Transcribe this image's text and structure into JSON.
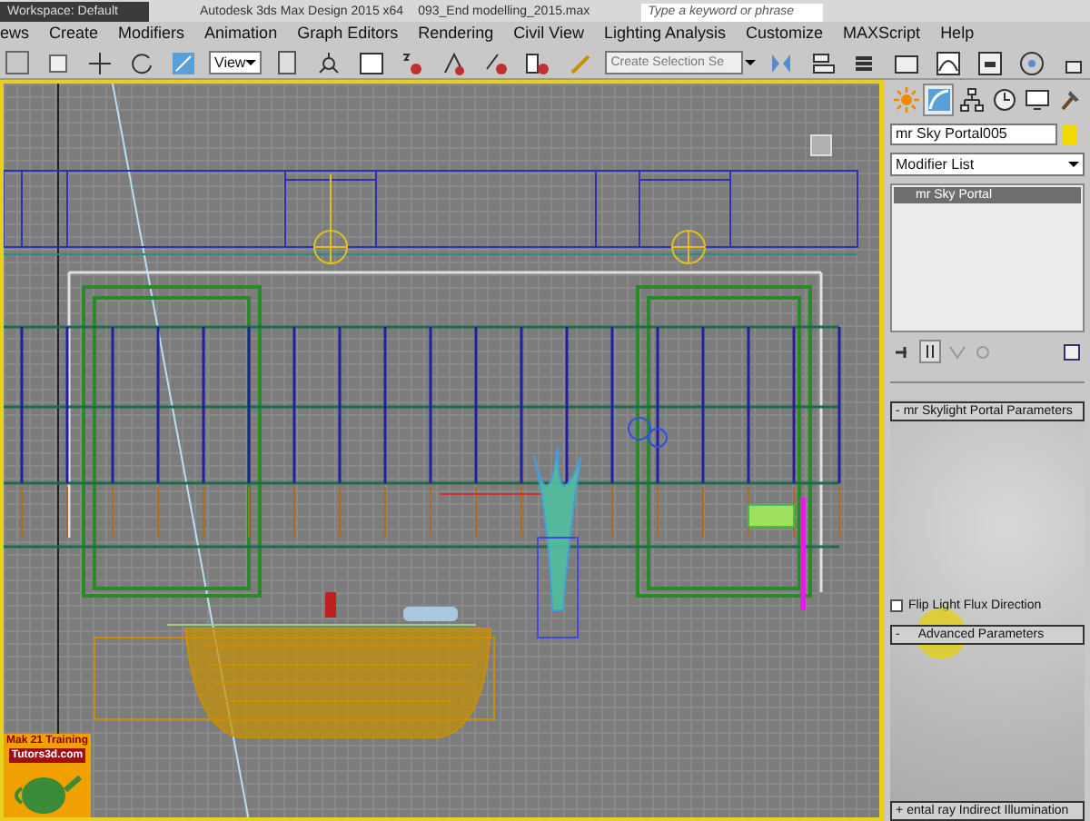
{
  "title_bar": {
    "workspace": "Workspace: Default",
    "app_title": "Autodesk 3ds Max Design 2015 x64",
    "file_name": "093_End modelling_2015.max",
    "search_placeholder": "Type a keyword or phrase"
  },
  "menu": [
    "ews",
    "Create",
    "Modifiers",
    "Animation",
    "Graph Editors",
    "Rendering",
    "Civil View",
    "Lighting Analysis",
    "Customize",
    "MAXScript",
    "Help"
  ],
  "toolbar": {
    "reference_dropdown": "View",
    "selection_set_placeholder": "Create Selection Se"
  },
  "command_panel": {
    "tabs": [
      {
        "kind": "create",
        "selected": false
      },
      {
        "kind": "modify",
        "selected": true
      },
      {
        "kind": "hierarchy",
        "selected": false
      },
      {
        "kind": "motion",
        "selected": false
      },
      {
        "kind": "display",
        "selected": false
      },
      {
        "kind": "utilities",
        "selected": false
      }
    ],
    "object_name": "mr Sky Portal005",
    "modifier_list": "Modifier List",
    "stack": [
      {
        "label": "mr Sky Portal",
        "selected": true
      }
    ],
    "rollouts": [
      {
        "sign": "-",
        "title": "mr Skylight Portal Parameters",
        "checkbox": {
          "label": "Flip Light Flux Direction",
          "checked": false
        }
      },
      {
        "sign": "-",
        "title": "Advanced Parameters"
      },
      {
        "sign": "+",
        "title": "ental ray Indirect Illumination"
      }
    ]
  },
  "logo": {
    "line_1": "Mak 21 Training",
    "line_2": "Tutors3d.com"
  }
}
